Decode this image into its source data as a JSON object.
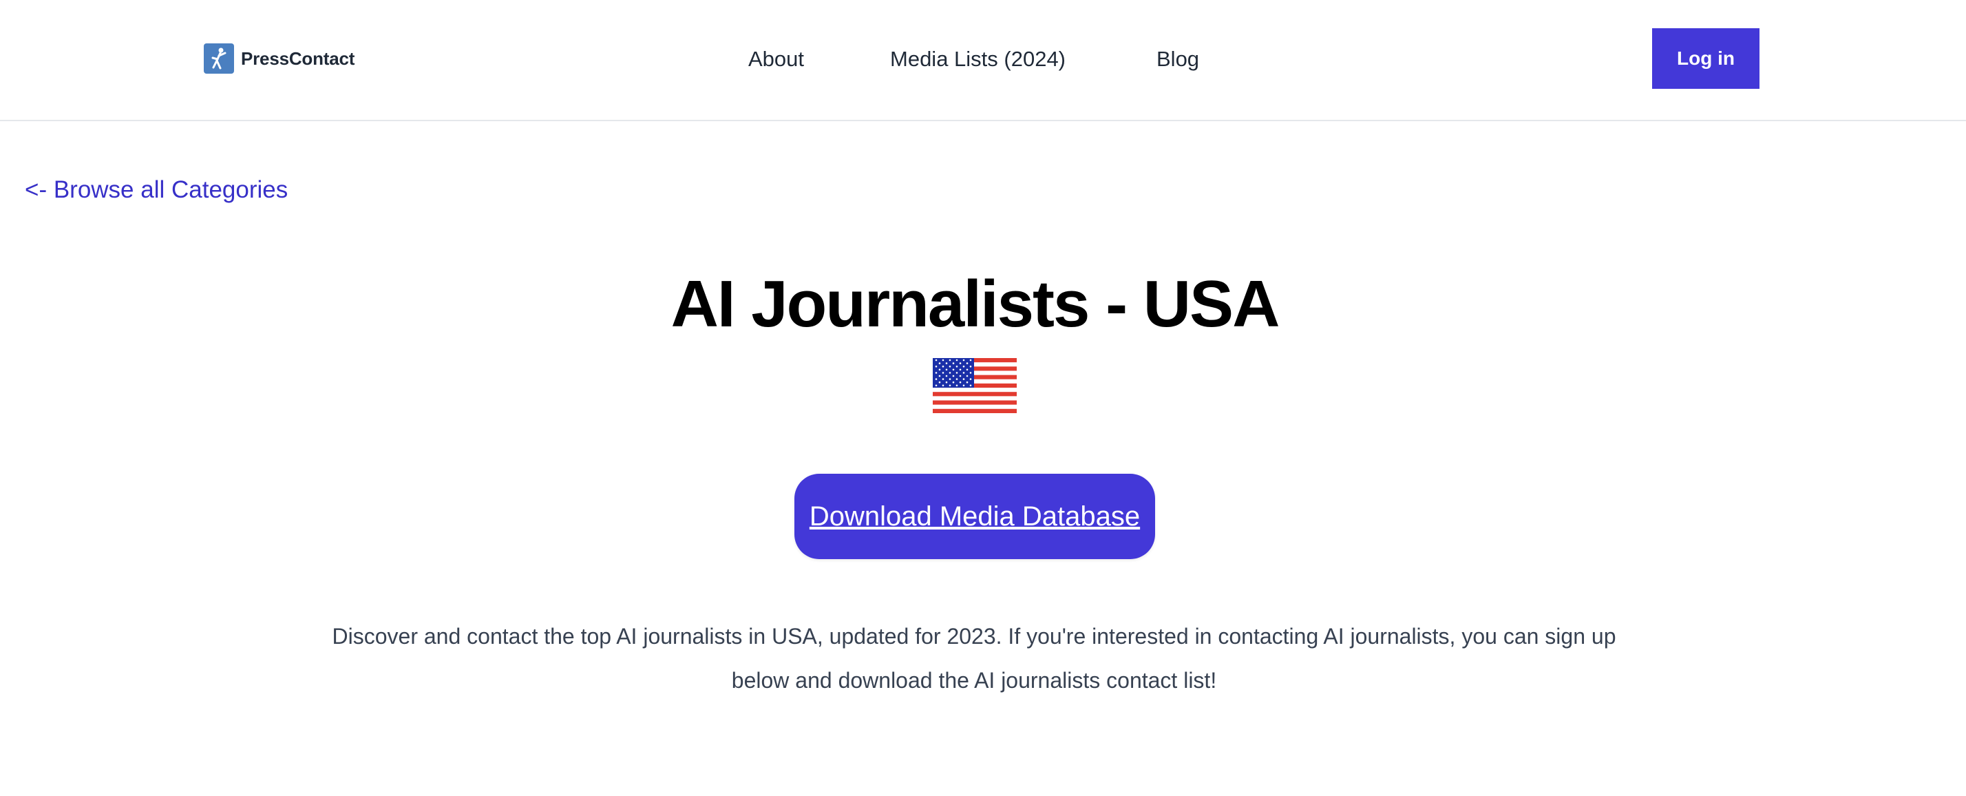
{
  "header": {
    "logo_text": "PressContact",
    "nav": {
      "about": "About",
      "media_lists": "Media Lists (2024)",
      "blog": "Blog"
    },
    "login_label": "Log in"
  },
  "main": {
    "back_link": "<- Browse all Categories",
    "title": "AI Journalists - USA",
    "download_label": "Download Media Database",
    "description": "Discover and contact the top AI journalists in USA, updated for 2023. If you're interested in contacting AI journalists, you can sign up below and download the AI journalists contact list!"
  },
  "icons": {
    "logo": "presscontact-logo-icon",
    "flag": "us-flag-icon"
  },
  "colors": {
    "accent": "#4338d8",
    "link": "#3730c8",
    "logo_mark": "#4a7fc0"
  }
}
